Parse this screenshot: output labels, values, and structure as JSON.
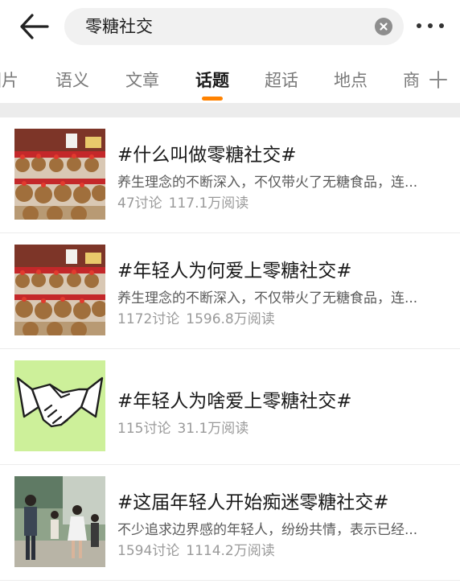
{
  "header": {
    "search_value": "零糖社交"
  },
  "tabs": [
    {
      "label": "图片"
    },
    {
      "label": "语义"
    },
    {
      "label": "文章"
    },
    {
      "label": "话题"
    },
    {
      "label": "超话"
    },
    {
      "label": "地点"
    },
    {
      "label": "商"
    }
  ],
  "active_tab": "话题",
  "colors": {
    "accent": "#ff8200",
    "separator": "#ececec"
  },
  "topics": [
    {
      "title": "#什么叫做零糖社交#",
      "desc": "养生理念的不断深入，不仅带火了无糖食品，连...",
      "discussions": "47讨论",
      "reads": "117.1万阅读",
      "thumb": "plush-toys"
    },
    {
      "title": "#年轻人为何爱上零糖社交#",
      "desc": "养生理念的不断深入，不仅带火了无糖食品，连...",
      "discussions": "1172讨论",
      "reads": "1596.8万阅读",
      "thumb": "plush-toys"
    },
    {
      "title": "#年轻人为啥爱上零糖社交#",
      "discussions": "115讨论",
      "reads": "31.1万阅读",
      "thumb": "handshake"
    },
    {
      "title": "#这届年轻人开始痴迷零糖社交#",
      "desc": "不少追求边界感的年轻人，纷纷共情，表示已经...",
      "discussions": "1594讨论",
      "reads": "1114.2万阅读",
      "thumb": "people-photo"
    }
  ]
}
